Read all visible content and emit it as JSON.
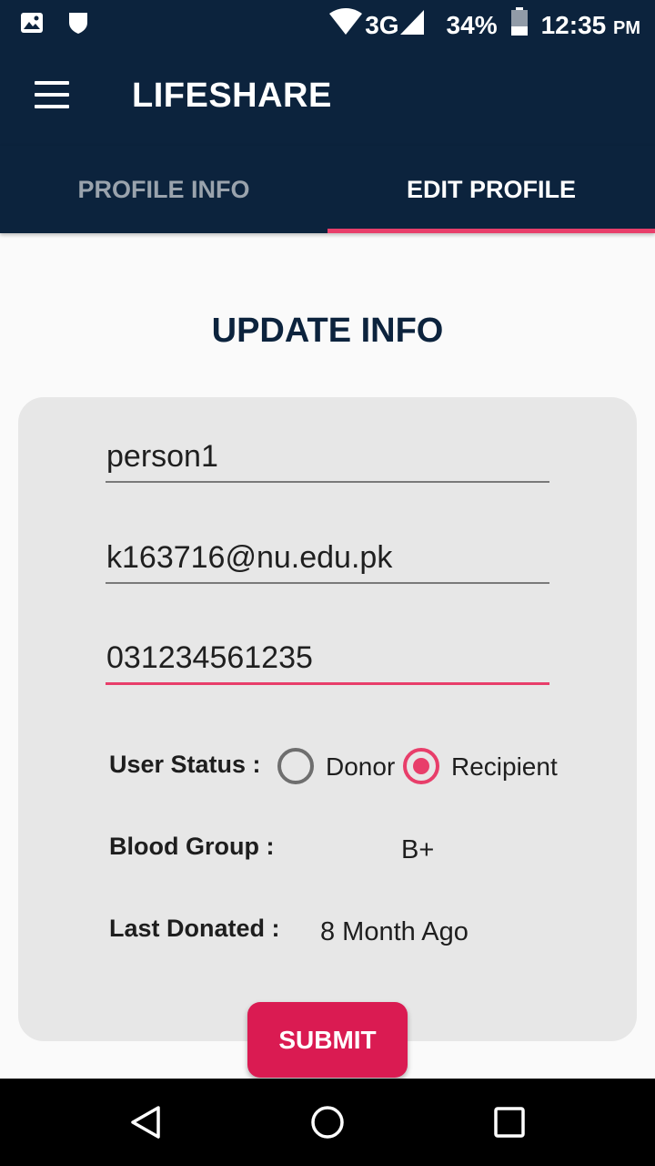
{
  "status_bar": {
    "icons": [
      "image-icon",
      "shield-icon",
      "wifi-icon",
      "signal-icon",
      "battery-icon"
    ],
    "network": "3G",
    "battery": "34%",
    "time": "12:35",
    "time_suffix": "PM"
  },
  "app_bar": {
    "title": "LIFESHARE",
    "menu_icon": "hamburger-menu-icon"
  },
  "tabs": [
    {
      "label": "PROFILE INFO",
      "active": false
    },
    {
      "label": "EDIT PROFILE",
      "active": true
    }
  ],
  "form": {
    "title": "UPDATE INFO",
    "name_value": "person1",
    "email_value": "k163716@nu.edu.pk",
    "phone_value": "031234561235",
    "user_status": {
      "label": "User Status :",
      "options": [
        {
          "label": "Donor",
          "selected": false
        },
        {
          "label": "Recipient",
          "selected": true
        }
      ]
    },
    "blood_group": {
      "label": "Blood Group :",
      "value": "B+"
    },
    "last_donated": {
      "label": "Last Donated :",
      "value": "8 Month Ago"
    },
    "submit_label": "SUBMIT"
  },
  "colors": {
    "primary": "#0c233d",
    "accent": "#e83e6a",
    "submit": "#da1b52",
    "card": "#e7e7e7"
  },
  "nav": [
    "back-icon",
    "home-icon",
    "recents-icon"
  ]
}
